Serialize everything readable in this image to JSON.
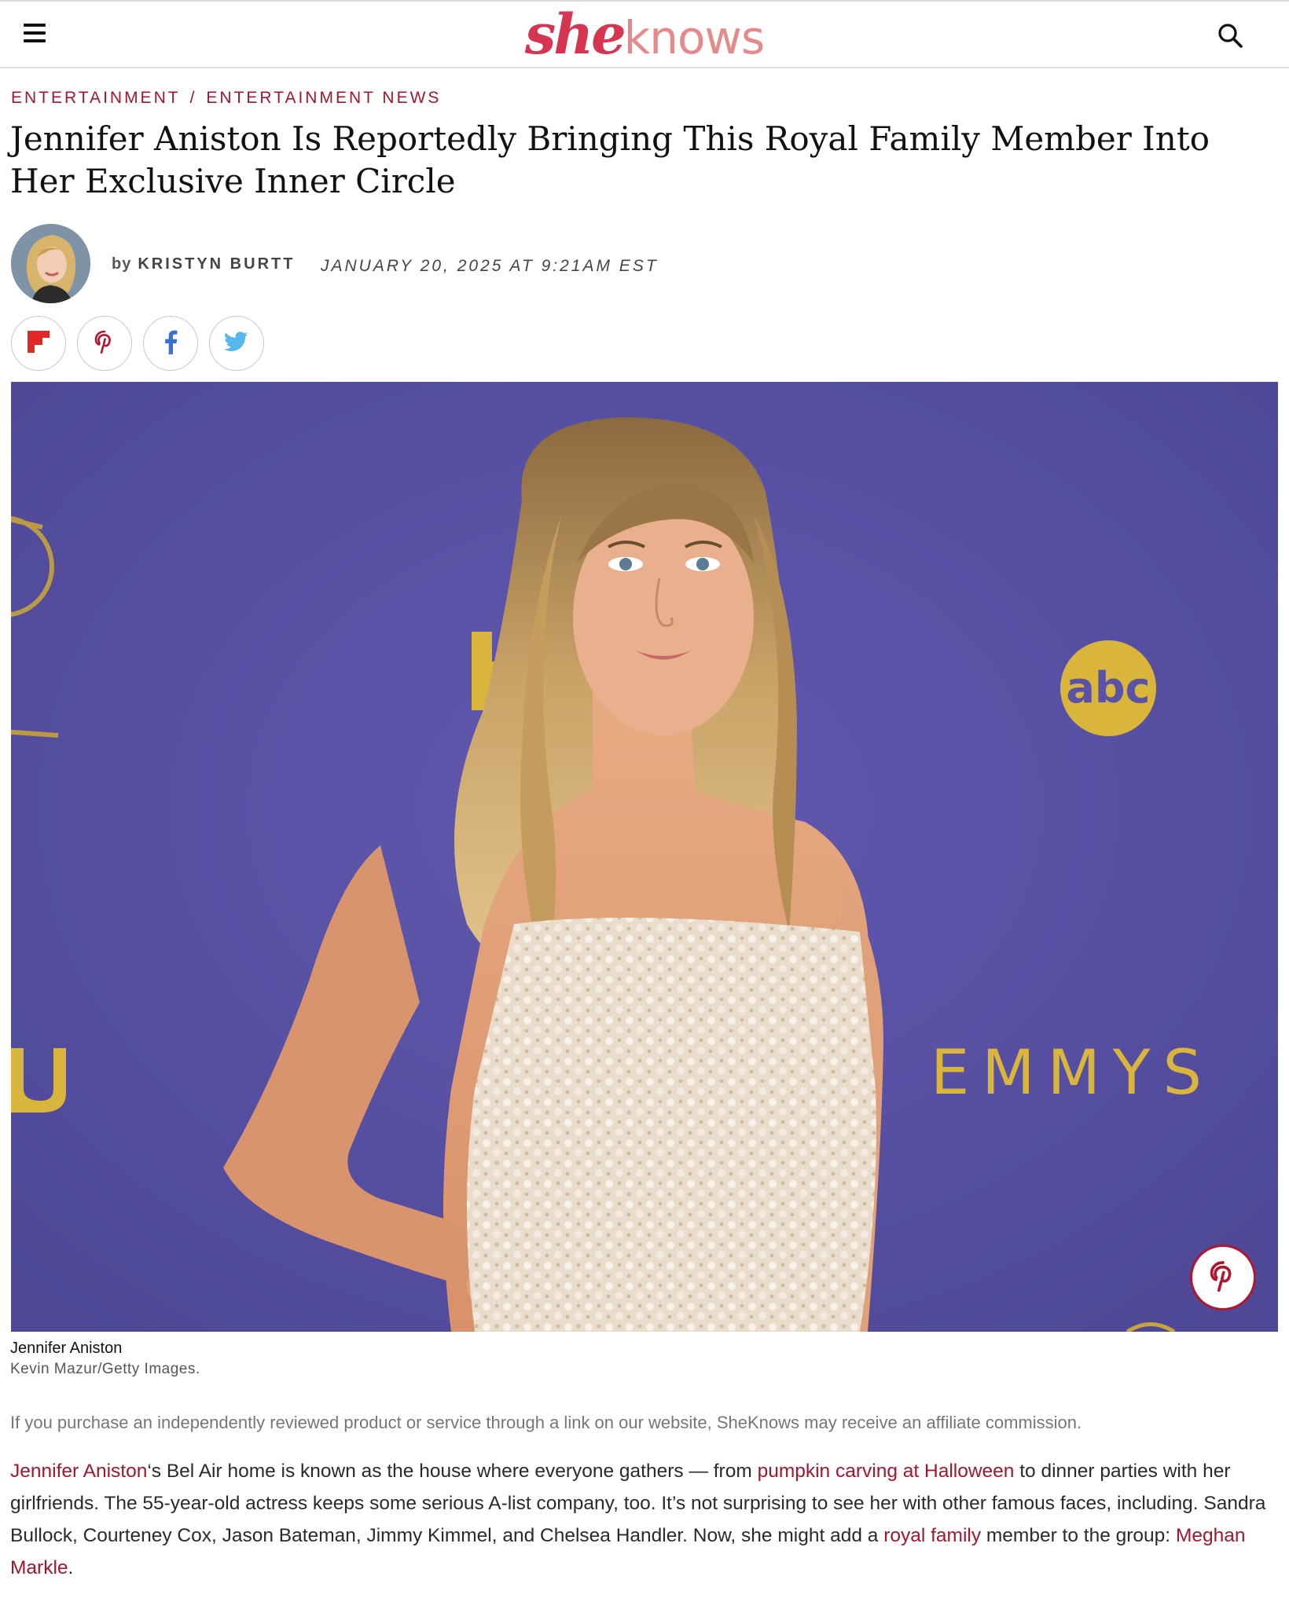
{
  "header": {
    "logo_she": "she",
    "logo_knows": "knows",
    "brand_color": "#d63552",
    "menu_icon": "hamburger-menu-icon",
    "search_icon": "search-icon"
  },
  "breadcrumb": {
    "items": [
      "ENTERTAINMENT",
      "ENTERTAINMENT NEWS"
    ],
    "separator": "/"
  },
  "article": {
    "title": "Jennifer Aniston Is Reportedly Bringing This Royal Family Member Into Her Exclusive Inner Circle",
    "by_prefix": "by",
    "author": "KRISTYN BURTT",
    "date": "JANUARY 20, 2025 AT 9:21AM EST"
  },
  "share_buttons": [
    "flipboard-icon",
    "pinterest-icon",
    "facebook-icon",
    "twitter-icon"
  ],
  "hero": {
    "caption_name": "Jennifer Aniston",
    "caption_credit": "Kevin Mazur/Getty Images.",
    "backdrop_color": "#5a52a6",
    "backdrop_text_right": "EMMYS",
    "backdrop_logo": "abc"
  },
  "disclaimer": "If you purchase an independently reviewed product or service through a link on our website, SheKnows may receive an affiliate commission.",
  "body": {
    "link_1": "Jennifer Aniston",
    "text_1": "‘s Bel Air home is known as the house where everyone gathers — from ",
    "link_2": "pumpkin carving at Halloween",
    "text_2": " to dinner parties with her girlfriends. The 55-year-old actress keeps some serious A-list company, too. It’s not surprising to see her with other famous faces, including. Sandra Bullock, Courteney Cox, Jason Bateman, Jimmy Kimmel, and Chelsea Handler. Now, she might add a ",
    "link_3": "royal family",
    "text_3": " member to the group: ",
    "link_4": "Meghan Markle",
    "text_4": "."
  }
}
